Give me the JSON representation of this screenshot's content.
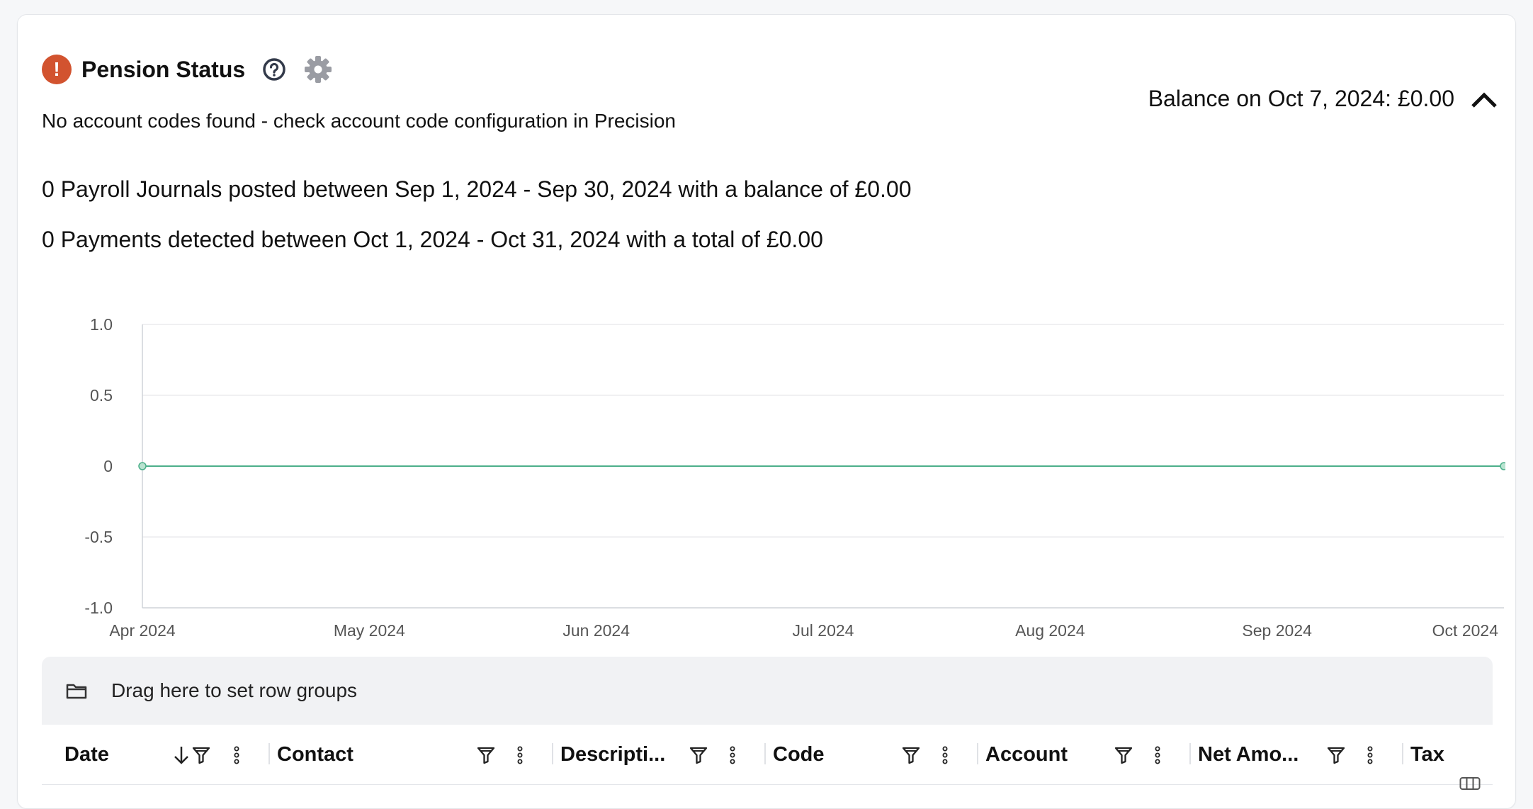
{
  "header": {
    "title": "Pension Status",
    "status_icon": "!",
    "message": "No account codes found - check account code configuration in Precision",
    "balance": "Balance on Oct 7, 2024: £0.00"
  },
  "summary": {
    "journals": "0 Payroll Journals posted between Sep 1, 2024 - Sep 30, 2024 with a balance of £0.00",
    "payments": "0 Payments detected between Oct 1, 2024 - Oct 31, 2024 with a total of £0.00"
  },
  "chart_data": {
    "type": "line",
    "title": "",
    "xlabel": "",
    "ylabel": "",
    "x_tick_labels": [
      "Apr 2024",
      "May 2024",
      "Jun 2024",
      "Jul 2024",
      "Aug 2024",
      "Sep 2024",
      "Oct 2024"
    ],
    "y_tick_labels": [
      "1.0",
      "0.5",
      "0",
      "-0.5",
      "-1.0"
    ],
    "ylim": [
      -1.0,
      1.0
    ],
    "grid": true,
    "series": [
      {
        "x": [
          "2024-04-01",
          "2024-10-07"
        ],
        "values": [
          0,
          0
        ],
        "color": "#4caf8a"
      }
    ]
  },
  "grid": {
    "groups_placeholder": "Drag here to set row groups",
    "columns": [
      {
        "label": "Date"
      },
      {
        "label": "Contact"
      },
      {
        "label": "Descripti..."
      },
      {
        "label": "Code"
      },
      {
        "label": "Account"
      },
      {
        "label": "Net Amo..."
      },
      {
        "label": "Tax"
      }
    ]
  },
  "colors": {
    "status_error": "#d2532f",
    "series_line": "#4caf8a"
  },
  "icons": [
    "exclamation-icon",
    "help-icon",
    "gear-icon",
    "chevron-up-icon",
    "folder-icon",
    "sort-desc-icon",
    "filter-icon",
    "menu-dots-icon",
    "columns-icon"
  ]
}
